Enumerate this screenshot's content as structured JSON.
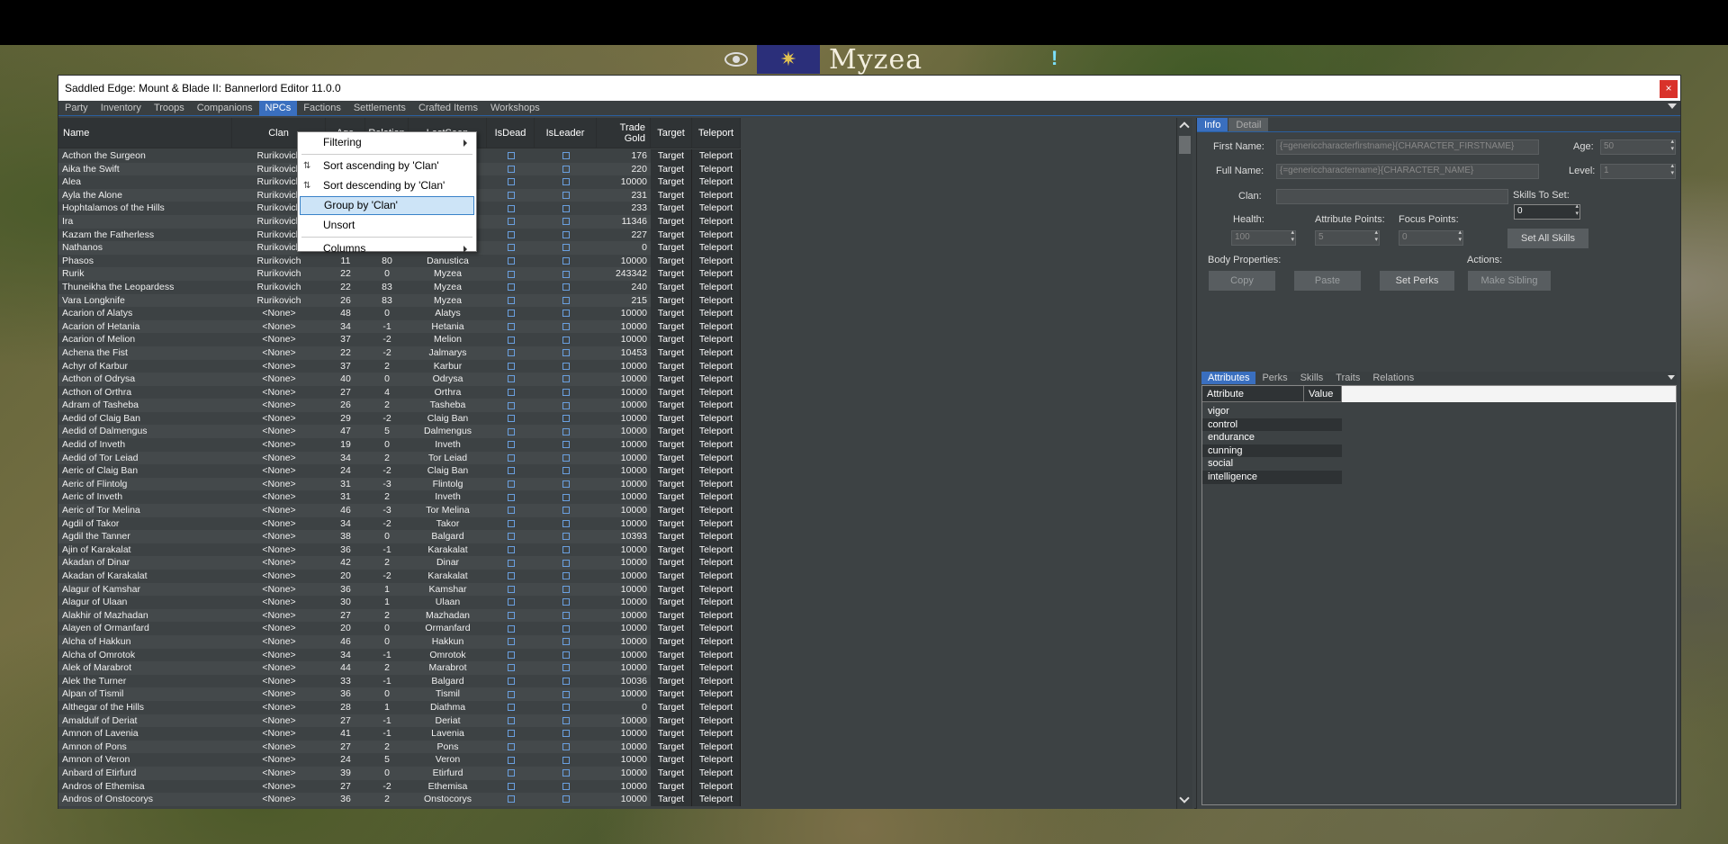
{
  "game": {
    "banner_name": "Myzea"
  },
  "window": {
    "title": "Saddled Edge:  Mount & Blade II: Bannerlord Editor 11.0.0",
    "close": "×"
  },
  "tabs": [
    "Party",
    "Inventory",
    "Troops",
    "Companions",
    "NPCs",
    "Factions",
    "Settlements",
    "Crafted Items",
    "Workshops"
  ],
  "active_tab": "NPCs",
  "grid": {
    "columns": {
      "name": "Name",
      "clan": "Clan",
      "age": "Age",
      "relation": "Relation",
      "last_seen": "LastSeen",
      "is_dead": "IsDead",
      "is_leader": "IsLeader",
      "trade_gold": "Trade Gold",
      "target": "Target",
      "teleport": "Teleport"
    },
    "target_label": "Target",
    "teleport_label": "Teleport",
    "rows": [
      [
        "Acthon the Surgeon",
        "Rurikovich",
        "",
        "",
        "Myzea",
        "176"
      ],
      [
        "Aika the Swift",
        "Rurikovich",
        "",
        "",
        "Myzea",
        "220"
      ],
      [
        "Alea",
        "Rurikovich",
        "",
        "",
        "Danustica",
        "10000"
      ],
      [
        "Ayla the Alone",
        "Rurikovich",
        "",
        "",
        "Myzea",
        "231"
      ],
      [
        "Hophtalamos of the Hills",
        "Rurikovich",
        "",
        "",
        "Myzea",
        "233"
      ],
      [
        "Ira",
        "Rurikovich",
        "",
        "",
        "Myzea",
        "11346"
      ],
      [
        "Kazam the Fatherless",
        "Rurikovich",
        "",
        "",
        "Myzea",
        "227"
      ],
      [
        "Nathanos",
        "Rurikovich",
        "",
        "",
        "Myzea",
        "0"
      ],
      [
        "Phasos",
        "Rurikovich",
        "11",
        "80",
        "Danustica",
        "10000"
      ],
      [
        "Rurik",
        "Rurikovich",
        "22",
        "0",
        "Myzea",
        "243342"
      ],
      [
        "Thuneikha the Leopardess",
        "Rurikovich",
        "22",
        "83",
        "Myzea",
        "240"
      ],
      [
        "Vara Longknife",
        "Rurikovich",
        "26",
        "83",
        "Myzea",
        "215"
      ],
      [
        "Acarion of Alatys",
        "<None>",
        "48",
        "0",
        "Alatys",
        "10000"
      ],
      [
        "Acarion of Hetania",
        "<None>",
        "34",
        "-1",
        "Hetania",
        "10000"
      ],
      [
        "Acarion of Melion",
        "<None>",
        "37",
        "-2",
        "Melion",
        "10000"
      ],
      [
        "Achena the Fist",
        "<None>",
        "22",
        "-2",
        "Jalmarys",
        "10453"
      ],
      [
        "Achyr of Karbur",
        "<None>",
        "37",
        "2",
        "Karbur",
        "10000"
      ],
      [
        "Acthon of Odrysa",
        "<None>",
        "40",
        "0",
        "Odrysa",
        "10000"
      ],
      [
        "Acthon of Orthra",
        "<None>",
        "27",
        "4",
        "Orthra",
        "10000"
      ],
      [
        "Adram of Tasheba",
        "<None>",
        "26",
        "2",
        "Tasheba",
        "10000"
      ],
      [
        "Aedid of Claig Ban",
        "<None>",
        "29",
        "-2",
        "Claig Ban",
        "10000"
      ],
      [
        "Aedid of Dalmengus",
        "<None>",
        "47",
        "5",
        "Dalmengus",
        "10000"
      ],
      [
        "Aedid of Inveth",
        "<None>",
        "19",
        "0",
        "Inveth",
        "10000"
      ],
      [
        "Aedid of Tor Leiad",
        "<None>",
        "34",
        "2",
        "Tor Leiad",
        "10000"
      ],
      [
        "Aeric of Claig Ban",
        "<None>",
        "24",
        "-2",
        "Claig Ban",
        "10000"
      ],
      [
        "Aeric of Flintolg",
        "<None>",
        "31",
        "-3",
        "Flintolg",
        "10000"
      ],
      [
        "Aeric of Inveth",
        "<None>",
        "31",
        "2",
        "Inveth",
        "10000"
      ],
      [
        "Aeric of Tor Melina",
        "<None>",
        "46",
        "-3",
        "Tor Melina",
        "10000"
      ],
      [
        "Agdil of Takor",
        "<None>",
        "34",
        "-2",
        "Takor",
        "10000"
      ],
      [
        "Agdil the Tanner",
        "<None>",
        "38",
        "0",
        "Balgard",
        "10393"
      ],
      [
        "Ajin of Karakalat",
        "<None>",
        "36",
        "-1",
        "Karakalat",
        "10000"
      ],
      [
        "Akadan of Dinar",
        "<None>",
        "42",
        "2",
        "Dinar",
        "10000"
      ],
      [
        "Akadan of Karakalat",
        "<None>",
        "20",
        "-2",
        "Karakalat",
        "10000"
      ],
      [
        "Alagur of Kamshar",
        "<None>",
        "36",
        "1",
        "Kamshar",
        "10000"
      ],
      [
        "Alagur of Ulaan",
        "<None>",
        "30",
        "1",
        "Ulaan",
        "10000"
      ],
      [
        "Alakhir of Mazhadan",
        "<None>",
        "27",
        "2",
        "Mazhadan",
        "10000"
      ],
      [
        "Alayen of Ormanfard",
        "<None>",
        "20",
        "0",
        "Ormanfard",
        "10000"
      ],
      [
        "Alcha of Hakkun",
        "<None>",
        "46",
        "0",
        "Hakkun",
        "10000"
      ],
      [
        "Alcha of Omrotok",
        "<None>",
        "34",
        "-1",
        "Omrotok",
        "10000"
      ],
      [
        "Alek of Marabrot",
        "<None>",
        "44",
        "2",
        "Marabrot",
        "10000"
      ],
      [
        "Alek the Turner",
        "<None>",
        "33",
        "-1",
        "Balgard",
        "10036"
      ],
      [
        "Alpan of Tismil",
        "<None>",
        "36",
        "0",
        "Tismil",
        "10000"
      ],
      [
        "Althegar of the Hills",
        "<None>",
        "28",
        "1",
        "Diathma",
        "0"
      ],
      [
        "Amaldulf of Deriat",
        "<None>",
        "27",
        "-1",
        "Deriat",
        "10000"
      ],
      [
        "Amnon of Lavenia",
        "<None>",
        "41",
        "-1",
        "Lavenia",
        "10000"
      ],
      [
        "Amnon of Pons",
        "<None>",
        "27",
        "2",
        "Pons",
        "10000"
      ],
      [
        "Amnon of Veron",
        "<None>",
        "24",
        "5",
        "Veron",
        "10000"
      ],
      [
        "Anbard of Etirfurd",
        "<None>",
        "39",
        "0",
        "Etirfurd",
        "10000"
      ],
      [
        "Andros of Ethemisa",
        "<None>",
        "27",
        "-2",
        "Ethemisa",
        "10000"
      ],
      [
        "Andros of Onstocorys",
        "<None>",
        "36",
        "2",
        "Onstocorys",
        "10000"
      ]
    ]
  },
  "context_menu": {
    "filtering": "Filtering",
    "sort_asc": "Sort ascending by 'Clan'",
    "sort_desc": "Sort descending by 'Clan'",
    "group_by": "Group by 'Clan'",
    "unsort": "Unsort",
    "columns": "Columns"
  },
  "detail": {
    "tabs": [
      "Info",
      "Detail"
    ],
    "active_tab": "Info",
    "first_name_label": "First Name:",
    "first_name_value": "{=genericcharacterfirstname}{CHARACTER_FIRSTNAME}",
    "full_name_label": "Full Name:",
    "full_name_value": "{=genericcharactername}{CHARACTER_NAME}",
    "age_label": "Age:",
    "age_value": "50",
    "level_label": "Level:",
    "level_value": "1",
    "clan_label": "Clan:",
    "clan_value": "",
    "skills_to_set_label": "Skills To Set:",
    "skills_to_set_value": "0",
    "health_label": "Health:",
    "health_value": "100",
    "attribute_points_label": "Attribute Points:",
    "attribute_points_value": "5",
    "focus_points_label": "Focus Points:",
    "focus_points_value": "0",
    "set_all_skills": "Set All Skills",
    "body_properties_label": "Body Properties:",
    "actions_label": "Actions:",
    "copy": "Copy",
    "paste": "Paste",
    "set_perks": "Set Perks",
    "make_sibling": "Make Sibling",
    "sub_tabs": [
      "Attributes",
      "Perks",
      "Skills",
      "Traits",
      "Relations"
    ],
    "active_sub_tab": "Attributes",
    "attr_headers": {
      "attribute": "Attribute",
      "value": "Value"
    },
    "attributes": [
      "vigor",
      "control",
      "endurance",
      "cunning",
      "social",
      "intelligence"
    ]
  },
  "colors": {
    "accent": "#3a6fbf",
    "panel": "#3d4244",
    "close": "#d9322a"
  }
}
